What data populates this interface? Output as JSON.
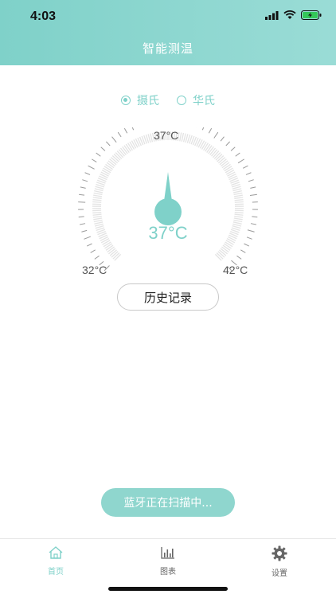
{
  "status_bar": {
    "time": "4:03"
  },
  "nav": {
    "title": "智能测温"
  },
  "units": [
    {
      "label": "摄氏",
      "selected": true
    },
    {
      "label": "华氏",
      "selected": false
    }
  ],
  "gauge": {
    "top_label": "37°C",
    "min_label": "32°C",
    "max_label": "42°C",
    "value_label": "37°C",
    "min": 32,
    "max": 42,
    "value": 37
  },
  "history_button": {
    "label": "历史记录"
  },
  "scan_status": {
    "text": "蓝牙正在扫描中..."
  },
  "tabs": [
    {
      "label": "首页",
      "icon": "home-icon",
      "active": true
    },
    {
      "label": "图表",
      "icon": "chart-icon",
      "active": false
    },
    {
      "label": "设置",
      "icon": "gear-icon",
      "active": false
    }
  ],
  "colors": {
    "accent": "#7fd1c9"
  }
}
